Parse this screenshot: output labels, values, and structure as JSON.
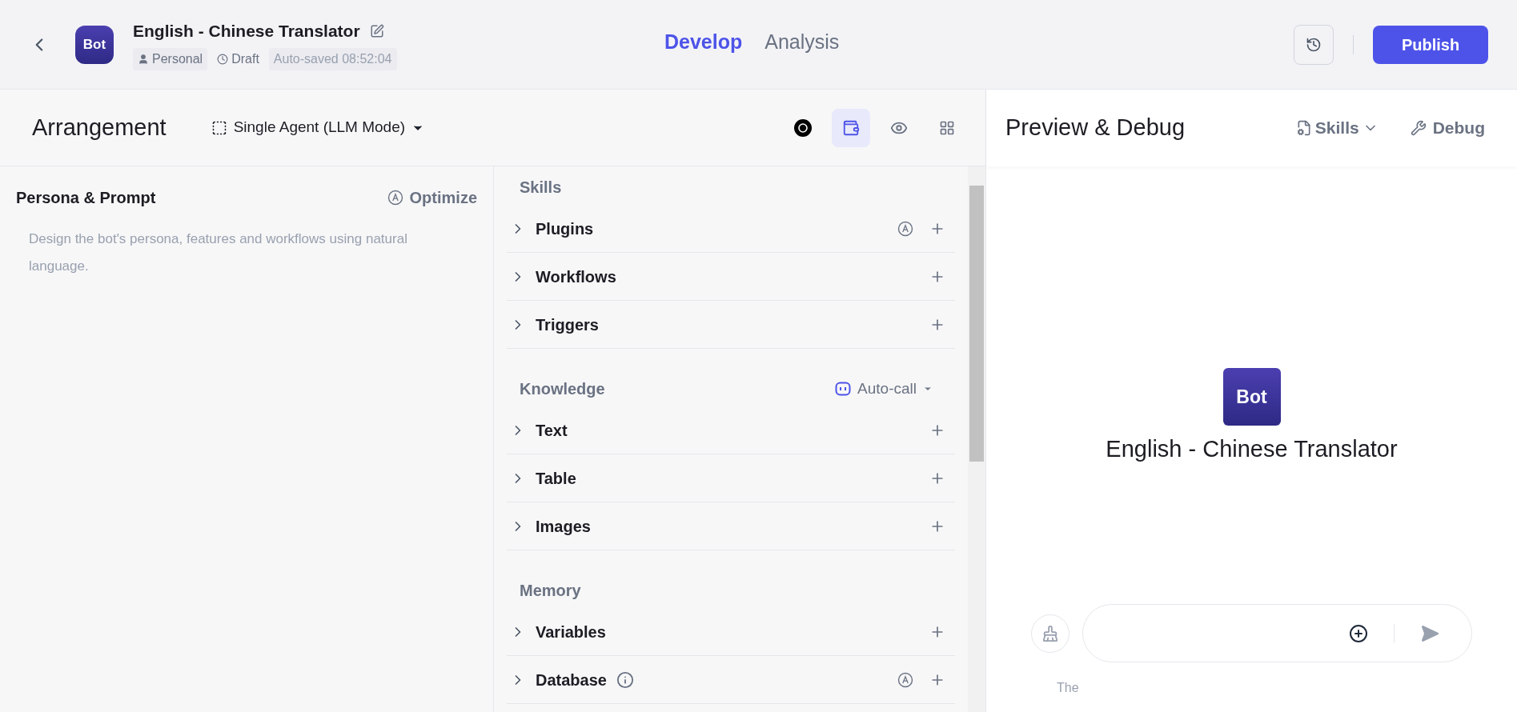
{
  "header": {
    "logo": "Bot",
    "title": "English - Chinese Translator",
    "owner": "Personal",
    "status": "Draft",
    "saved": "Auto-saved 08:52:04",
    "tabs": [
      {
        "label": "Develop",
        "selected": true
      },
      {
        "label": "Analysis",
        "selected": false
      }
    ],
    "publish": "Publish"
  },
  "arrangement": {
    "title": "Arrangement",
    "mode": "Single Agent (LLM Mode)",
    "tools": [
      {
        "kind": "model",
        "selected": false
      },
      {
        "kind": "wallet",
        "selected": true
      },
      {
        "kind": "eye",
        "selected": false
      },
      {
        "kind": "grid",
        "selected": false
      }
    ]
  },
  "persona": {
    "title": "Persona & Prompt",
    "optimize": "Optimize",
    "placeholder": "Design the bot's persona, features and workflows using natural language."
  },
  "sections": [
    {
      "title": "Skills",
      "items": [
        {
          "label": "Plugins",
          "kind": "auto"
        },
        {
          "label": "Workflows",
          "kind": "plain"
        },
        {
          "label": "Triggers",
          "kind": "plain"
        }
      ]
    },
    {
      "title": "Knowledge",
      "action": "Auto-call",
      "items": [
        {
          "label": "Text",
          "kind": "plain"
        },
        {
          "label": "Table",
          "kind": "plain"
        },
        {
          "label": "Images",
          "kind": "plain"
        }
      ]
    },
    {
      "title": "Memory",
      "items": [
        {
          "label": "Variables",
          "kind": "plain"
        },
        {
          "label": "Database",
          "kind": "info_auto"
        }
      ]
    }
  ],
  "preview": {
    "title": "Preview & Debug",
    "skills": "Skills",
    "debug": "Debug",
    "logo": "Bot",
    "bot_name": "English - Chinese Translator",
    "disclaimer": "The"
  }
}
